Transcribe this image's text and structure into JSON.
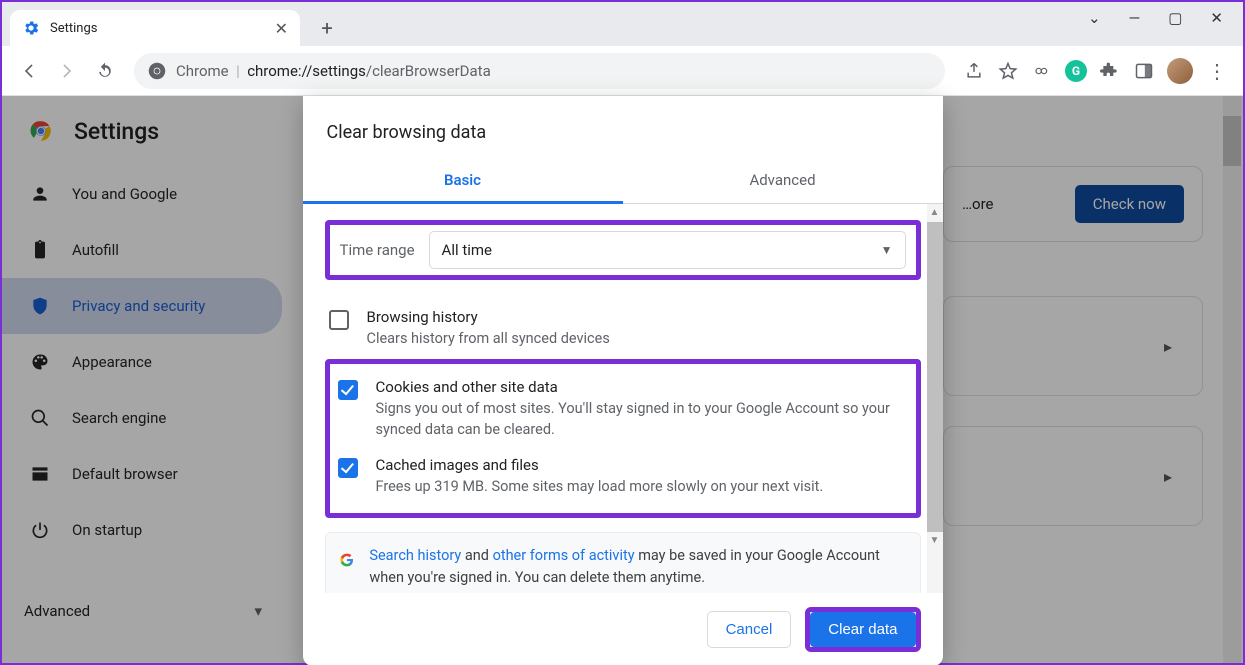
{
  "window": {
    "tab_title": "Settings"
  },
  "omnibox": {
    "prefix": "Chrome",
    "url_dark": "chrome://settings",
    "url_rest": "/clearBrowserData"
  },
  "page": {
    "title": "Settings"
  },
  "nav": {
    "items": [
      {
        "label": "You and Google"
      },
      {
        "label": "Autofill"
      },
      {
        "label": "Privacy and security"
      },
      {
        "label": "Appearance"
      },
      {
        "label": "Search engine"
      },
      {
        "label": "Default browser"
      },
      {
        "label": "On startup"
      }
    ],
    "advanced": "Advanced"
  },
  "promo": {
    "text": "…ore",
    "button": "Check now"
  },
  "modal": {
    "title": "Clear browsing data",
    "tabs": {
      "basic": "Basic",
      "advanced": "Advanced"
    },
    "time_label": "Time range",
    "time_value": "All time",
    "rows": [
      {
        "title": "Browsing history",
        "desc": "Clears history from all synced devices"
      },
      {
        "title": "Cookies and other site data",
        "desc": "Signs you out of most sites. You'll stay signed in to your Google Account so your synced data can be cleared."
      },
      {
        "title": "Cached images and files",
        "desc": "Frees up 319 MB. Some sites may load more slowly on your next visit."
      }
    ],
    "info": {
      "link1": "Search history",
      "mid1": " and ",
      "link2": "other forms of activity",
      "rest": " may be saved in your Google Account when you're signed in. You can delete them anytime."
    },
    "cancel": "Cancel",
    "clear": "Clear data"
  }
}
